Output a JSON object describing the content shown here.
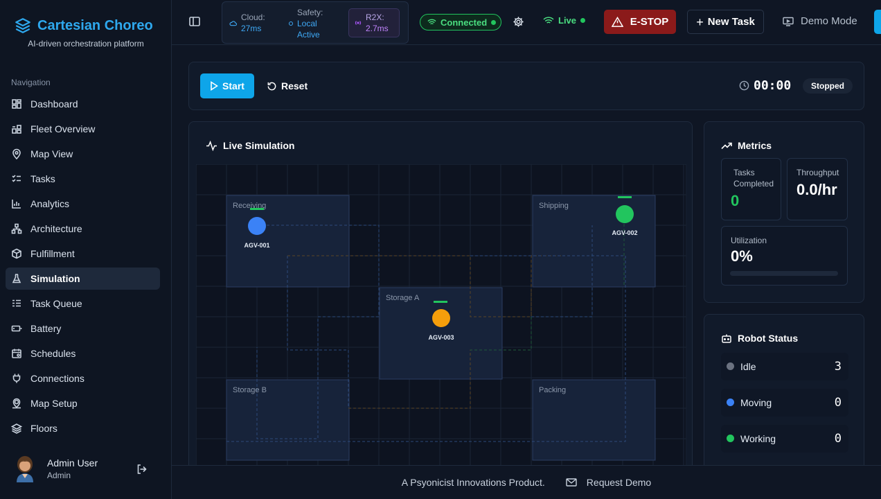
{
  "brand": {
    "title": "Cartesian Choreo",
    "subtitle": "AI-driven orchestration platform"
  },
  "sidebar": {
    "heading": "Navigation",
    "items": [
      {
        "label": "Dashboard",
        "icon": "dashboard-icon"
      },
      {
        "label": "Fleet Overview",
        "icon": "fleet-icon"
      },
      {
        "label": "Map View",
        "icon": "map-pin-icon"
      },
      {
        "label": "Tasks",
        "icon": "tasks-icon"
      },
      {
        "label": "Analytics",
        "icon": "chart-icon"
      },
      {
        "label": "Architecture",
        "icon": "network-icon"
      },
      {
        "label": "Fulfillment",
        "icon": "package-icon"
      },
      {
        "label": "Simulation",
        "icon": "flask-icon",
        "active": true
      },
      {
        "label": "Task Queue",
        "icon": "queue-icon"
      },
      {
        "label": "Battery",
        "icon": "battery-icon"
      },
      {
        "label": "Schedules",
        "icon": "calendar-icon"
      },
      {
        "label": "Connections",
        "icon": "plug-icon"
      },
      {
        "label": "Map Setup",
        "icon": "map-setup-icon"
      },
      {
        "label": "Floors",
        "icon": "layers-icon"
      }
    ],
    "user": {
      "name": "Admin User",
      "role": "Admin"
    }
  },
  "topbar": {
    "cloud_label": "Cloud:",
    "cloud_value": "27ms",
    "safety_label": "Safety:",
    "safety_value_1": "Local",
    "safety_value_2": "Active",
    "r2x_label": "R2X:",
    "r2x_value": "2.7ms",
    "connected": "Connected",
    "live": "Live",
    "estop": "E-STOP",
    "new_task": "New Task",
    "demo_mode": "Demo Mode"
  },
  "controls": {
    "start": "Start",
    "reset": "Reset",
    "timer": "00:00",
    "status": "Stopped"
  },
  "simulation": {
    "title": "Live Simulation",
    "zones": [
      "Receiving",
      "Shipping",
      "Storage A",
      "Storage B",
      "Packing"
    ],
    "robots": [
      {
        "id": "AGV-001",
        "color": "#3b82f6"
      },
      {
        "id": "AGV-002",
        "color": "#22c55e"
      },
      {
        "id": "AGV-003",
        "color": "#f59e0b"
      }
    ]
  },
  "metrics": {
    "title": "Metrics",
    "tasks_label_1": "Tasks",
    "tasks_label_2": "Completed",
    "tasks_value": "0",
    "throughput_label": "Throughput",
    "throughput_value": "0.0/hr",
    "utilization_label": "Utilization",
    "utilization_value": "0%",
    "utilization_fraction": 0
  },
  "robot_status": {
    "title": "Robot Status",
    "rows": [
      {
        "label": "Idle",
        "count": "3",
        "color": "#6b7280"
      },
      {
        "label": "Moving",
        "count": "0",
        "color": "#3b82f6"
      },
      {
        "label": "Working",
        "count": "0",
        "color": "#22c55e"
      }
    ]
  },
  "footer": {
    "product": "A Psyonicist Innovations Product.",
    "demo": "Request Demo"
  },
  "colors": {
    "accent": "#0ea5e9",
    "brand": "#2ea8ee",
    "success": "#22c55e",
    "danger": "#8b1a1a"
  }
}
